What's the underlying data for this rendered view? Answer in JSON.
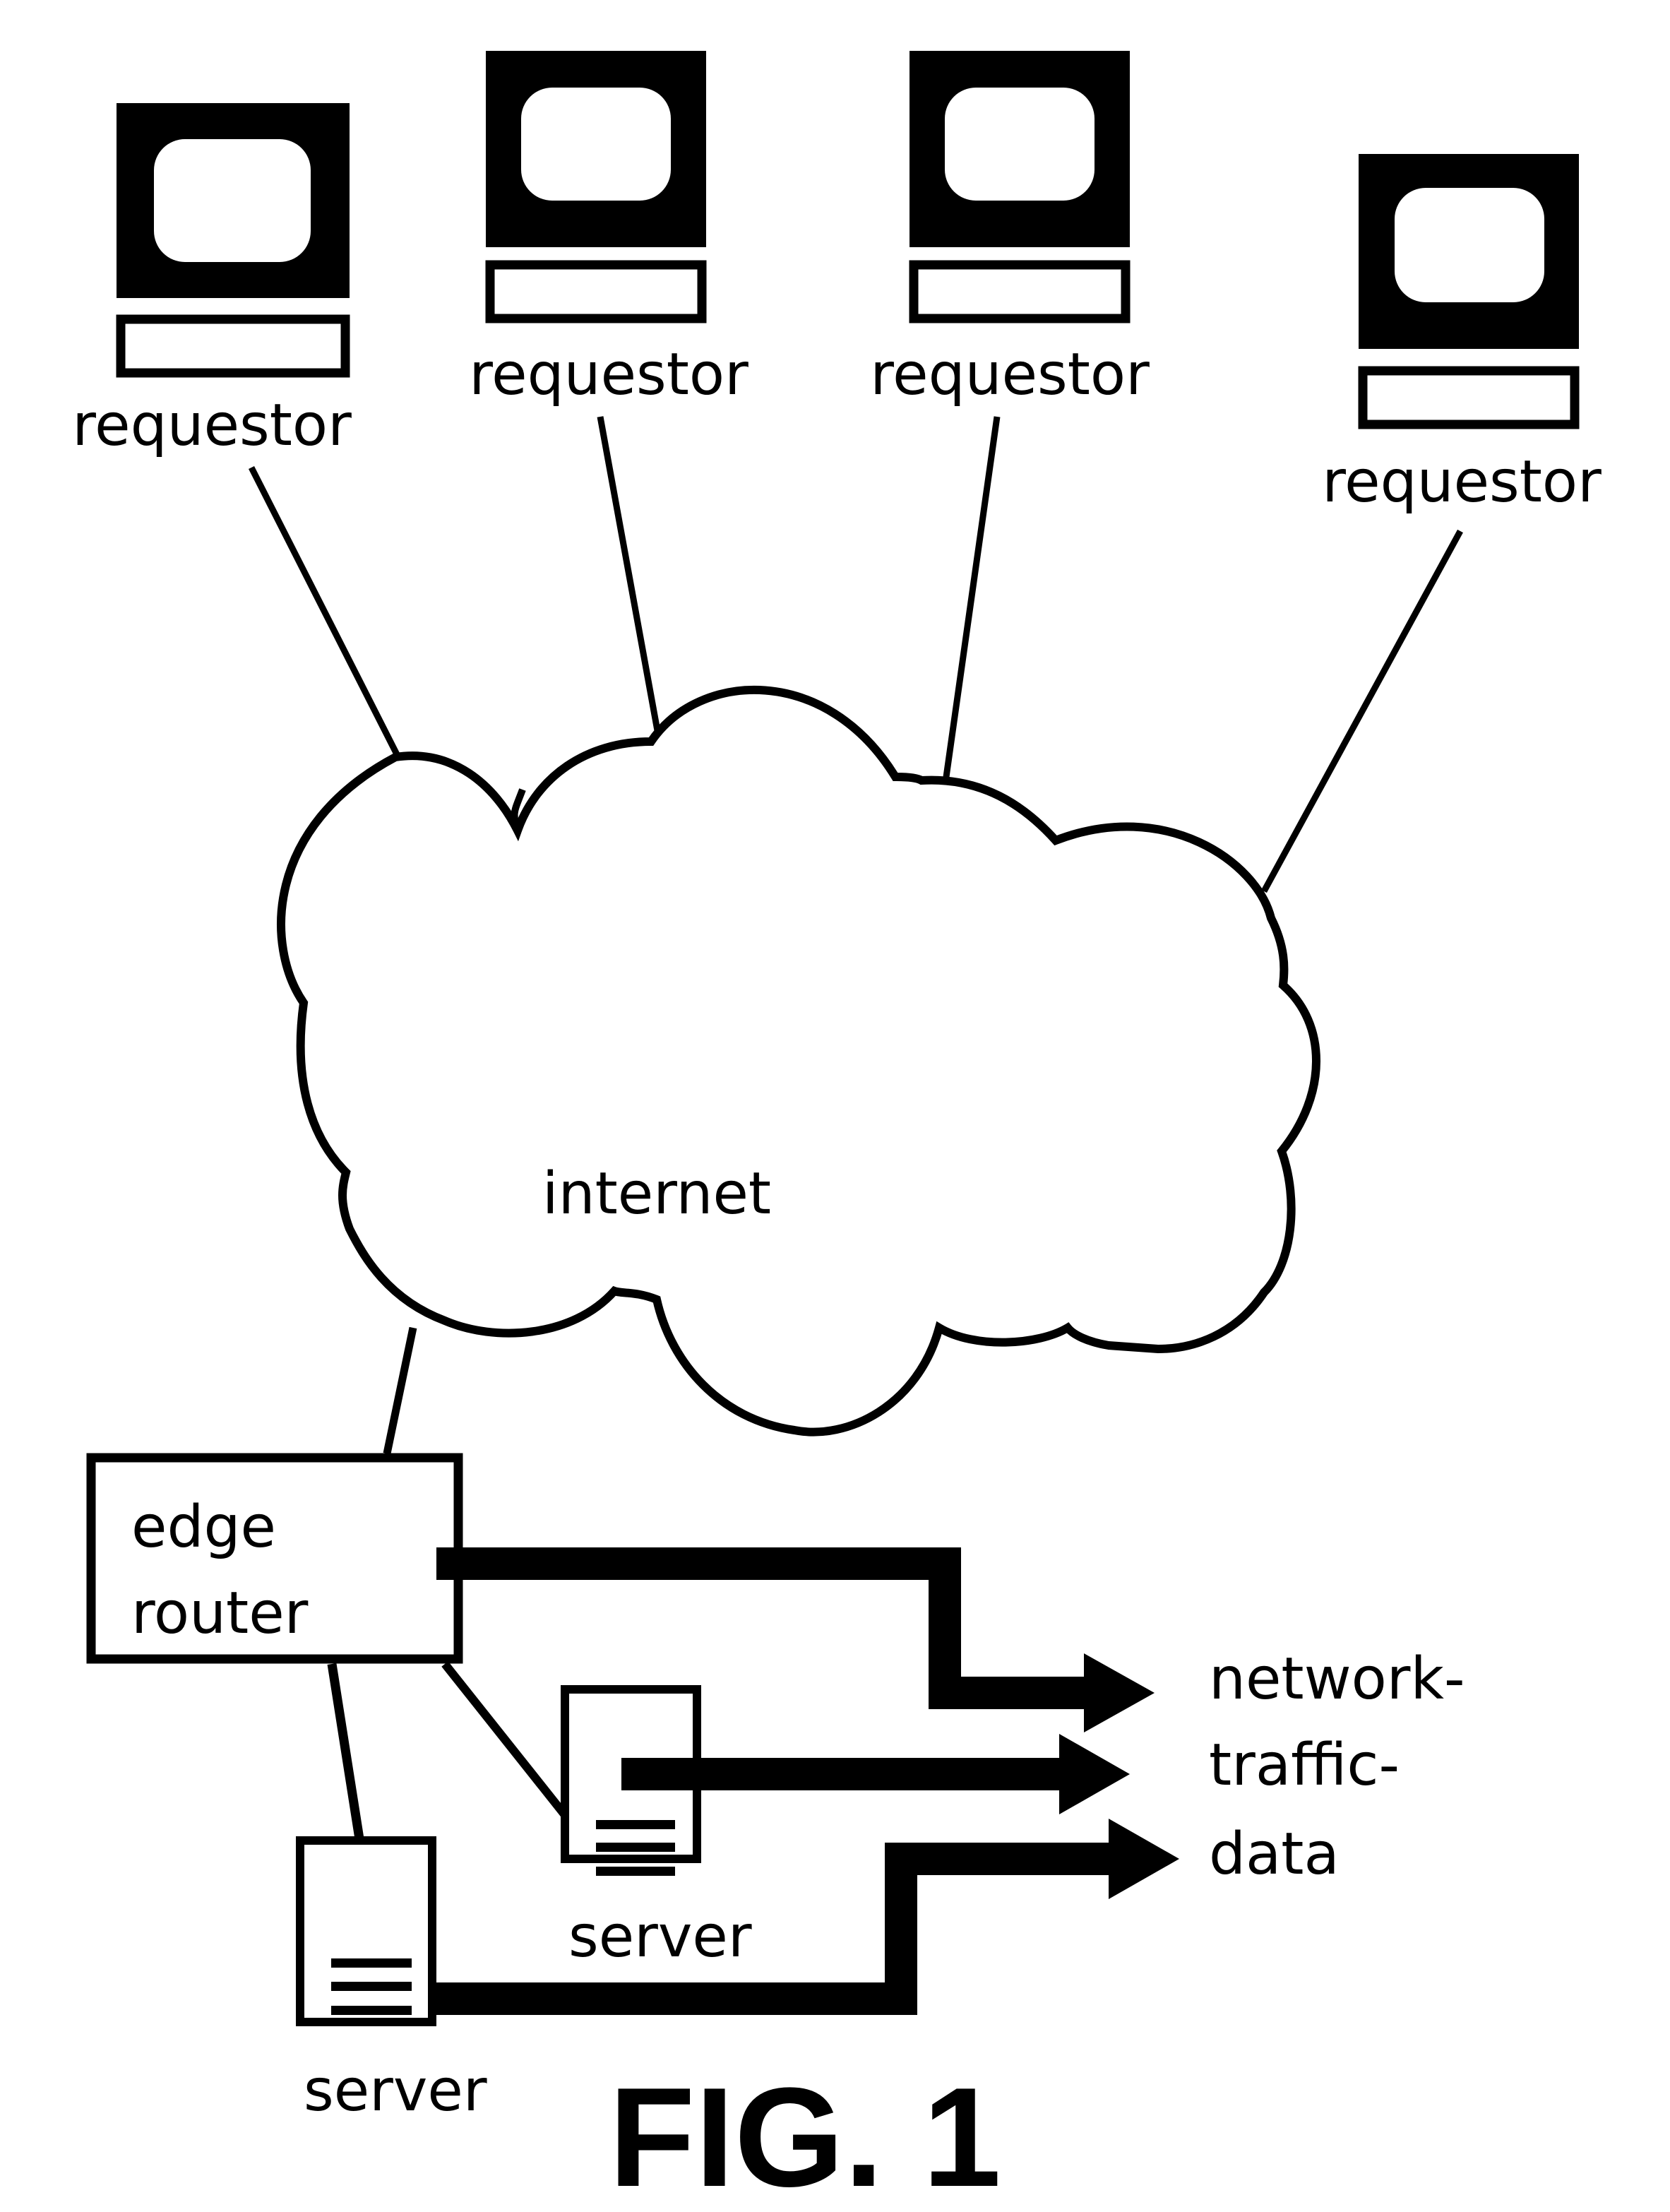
{
  "figure": {
    "caption": "FIG. 1",
    "colors": {
      "ink": "#000000",
      "paper": "#ffffff"
    }
  },
  "requestors": [
    {
      "label": "requestor",
      "icon": "computer-terminal-icon"
    },
    {
      "label": "requestor",
      "icon": "computer-terminal-icon"
    },
    {
      "label": "requestor",
      "icon": "computer-terminal-icon"
    },
    {
      "label": "requestor",
      "icon": "computer-terminal-icon"
    }
  ],
  "network": {
    "label": "internet",
    "icon": "cloud-icon"
  },
  "router": {
    "line1": "edge",
    "line2": "router"
  },
  "servers": [
    {
      "label": "server",
      "icon": "server-tower-icon"
    },
    {
      "label": "server",
      "icon": "server-tower-icon"
    }
  ],
  "output": {
    "line1": "network-",
    "line2": "traffic-",
    "line3": "data"
  }
}
